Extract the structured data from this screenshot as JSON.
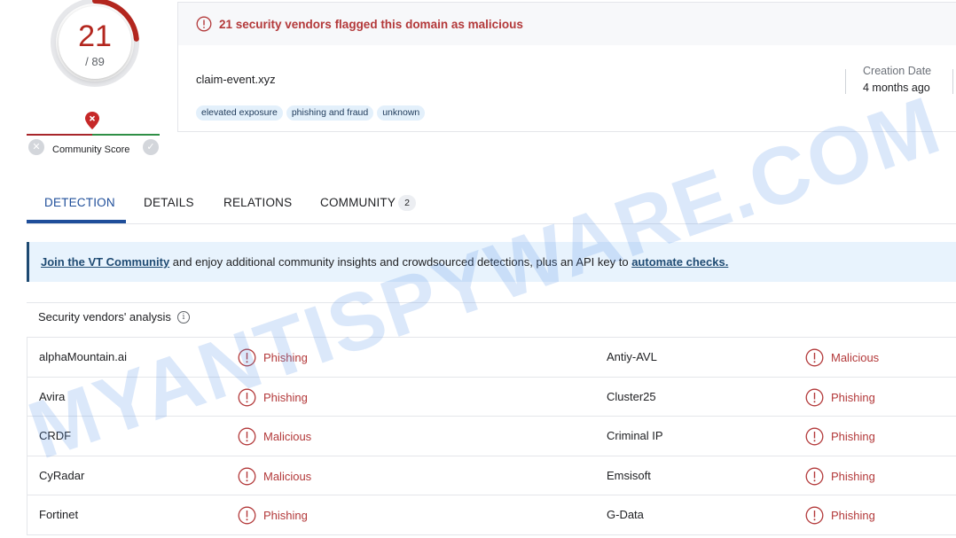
{
  "score": {
    "detections": "21",
    "total": "/ 89",
    "fraction": 0.236,
    "color": "#b3261e"
  },
  "community_score": {
    "label": "Community Score",
    "pin_icon": "map-pin-x-icon",
    "negative_icon": "x-icon",
    "positive_icon": "check-icon"
  },
  "header": {
    "alert_text": "21 security vendors flagged this domain as malicious",
    "domain": "claim-event.xyz",
    "tags": [
      "elevated exposure",
      "phishing and fraud",
      "unknown"
    ],
    "creation_label": "Creation Date",
    "creation_value": "4 months ago"
  },
  "tabs": [
    {
      "label": "DETECTION",
      "active": true
    },
    {
      "label": "DETAILS",
      "active": false
    },
    {
      "label": "RELATIONS",
      "active": false
    },
    {
      "label": "COMMUNITY",
      "active": false,
      "badge": "2"
    }
  ],
  "banner": {
    "link1": "Join the VT Community",
    "middle": " and enjoy additional community insights and crowdsourced detections, plus an API key to ",
    "link2": "automate checks."
  },
  "vendors": {
    "title": "Security vendors' analysis",
    "rows": [
      {
        "left": {
          "name": "alphaMountain.ai",
          "result": "Phishing"
        },
        "right": {
          "name": "Antiy-AVL",
          "result": "Malicious"
        }
      },
      {
        "left": {
          "name": "Avira",
          "result": "Phishing"
        },
        "right": {
          "name": "Cluster25",
          "result": "Phishing"
        }
      },
      {
        "left": {
          "name": "CRDF",
          "result": "Malicious"
        },
        "right": {
          "name": "Criminal IP",
          "result": "Phishing"
        }
      },
      {
        "left": {
          "name": "CyRadar",
          "result": "Malicious"
        },
        "right": {
          "name": "Emsisoft",
          "result": "Phishing"
        }
      },
      {
        "left": {
          "name": "Fortinet",
          "result": "Phishing"
        },
        "right": {
          "name": "G-Data",
          "result": "Phishing"
        }
      }
    ]
  },
  "watermark": "MYANTISPYWARE.COM"
}
